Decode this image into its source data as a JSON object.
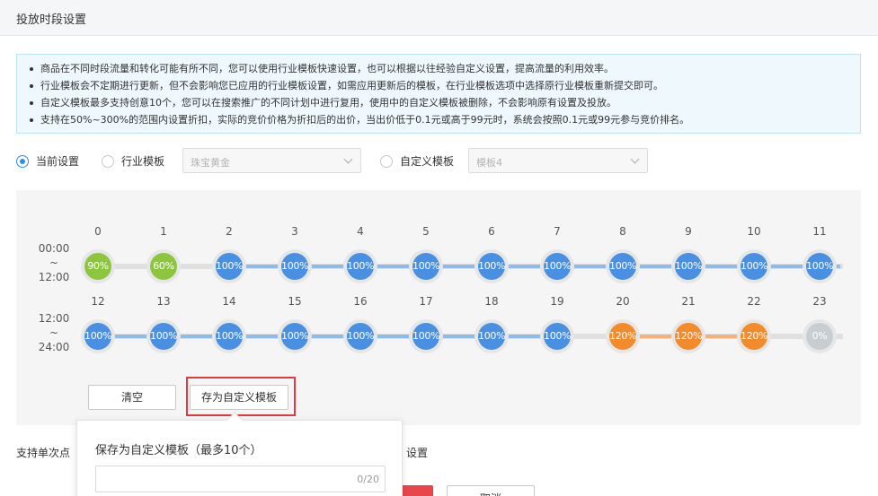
{
  "page": {
    "title": "投放时段设置"
  },
  "tips": [
    "商品在不同时段流量和转化可能有所不同，您可以使用行业模板快速设置，也可以根据以往经验自定义设置，提高流量的利用效率。",
    "行业模板会不定期进行更新，但不会影响您已应用的行业模板设置，如需应用更新后的模板，在行业模板选项中选择原行业模板重新提交即可。",
    "自定义模板最多支持创意10个，您可以在搜索推广的不同计划中进行复用，使用中的自定义模板被删除，不会影响原有设置及投放。",
    "支持在50%~300%的范围内设置折扣，实际的竞价价格为折扣后的出价，当出价低于0.1元或高于99元时，系统会按照0.1元或99元参与竞价排名。"
  ],
  "options": {
    "current": {
      "label": "当前设置",
      "selected": true
    },
    "industry": {
      "label": "行业模板",
      "selected": false,
      "select_value": "珠宝黄金"
    },
    "custom": {
      "label": "自定义模板",
      "selected": false,
      "select_value": "模板4"
    }
  },
  "schedule": {
    "row1": {
      "label_top": "00:00",
      "label_mid": "~",
      "label_bottom": "12:00"
    },
    "row2": {
      "label_top": "12:00",
      "label_mid": "~",
      "label_bottom": "24:00"
    },
    "hours": [
      "0",
      "1",
      "2",
      "3",
      "4",
      "5",
      "6",
      "7",
      "8",
      "9",
      "10",
      "11",
      "12",
      "13",
      "14",
      "15",
      "16",
      "17",
      "18",
      "19",
      "20",
      "21",
      "22",
      "23"
    ],
    "values": [
      "90%",
      "60%",
      "100%",
      "100%",
      "100%",
      "100%",
      "100%",
      "100%",
      "100%",
      "100%",
      "100%",
      "100%",
      "100%",
      "100%",
      "100%",
      "100%",
      "100%",
      "100%",
      "100%",
      "100%",
      "120%",
      "120%",
      "120%",
      "0%"
    ]
  },
  "actions": {
    "clear": "清空",
    "save_template": "存为自定义模板"
  },
  "popover": {
    "title": "保存为自定义模板（最多10个）",
    "counter": "0/20"
  },
  "footer": {
    "hint_left": "支持单次点",
    "hint_right": "设置",
    "cancel": "取消"
  },
  "colors": {
    "green": "#8cc63f",
    "blue": "#4a90e2",
    "orange": "#f28b2c",
    "gray": "#c8cdd2",
    "accent_red": "#e0393e"
  }
}
